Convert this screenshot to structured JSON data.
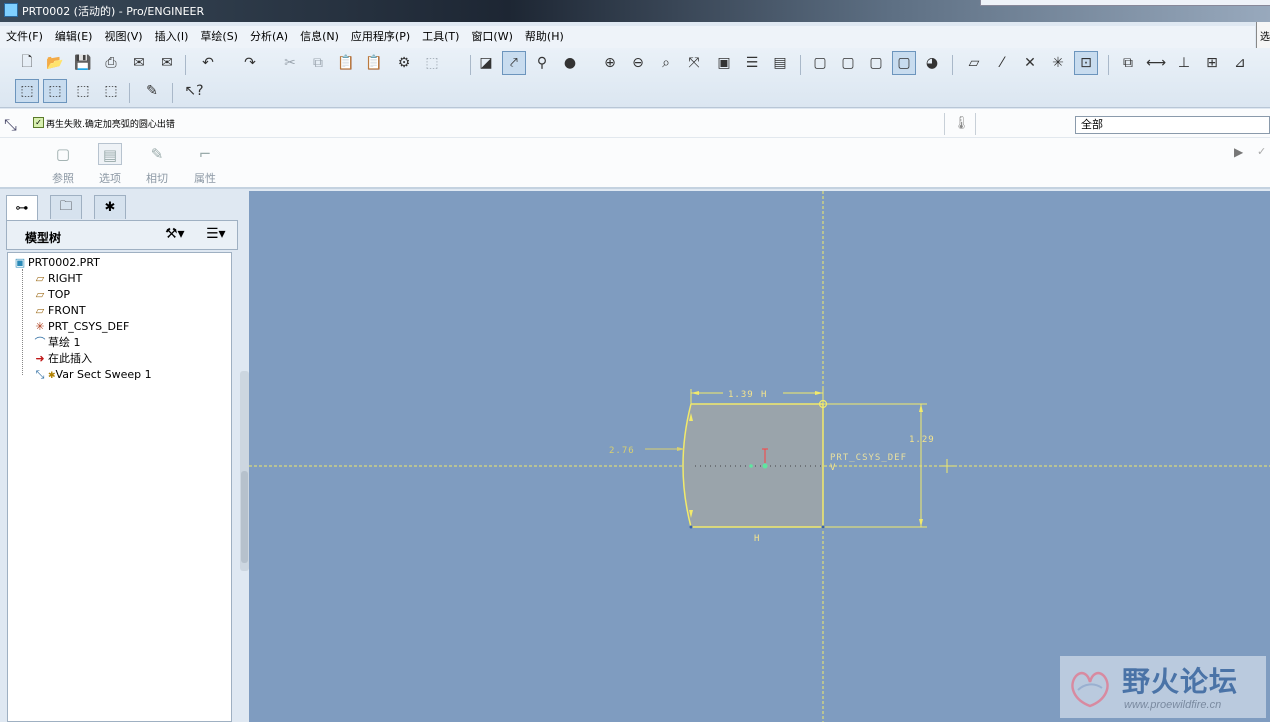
{
  "window": {
    "title": "PRT0002 (活动的) - Pro/ENGINEER"
  },
  "menu": {
    "items": [
      "文件(F)",
      "编辑(E)",
      "视图(V)",
      "插入(I)",
      "草绘(S)",
      "分析(A)",
      "信息(N)",
      "应用程序(P)",
      "工具(T)",
      "窗口(W)",
      "帮助(H)"
    ]
  },
  "side_panel": {
    "label": "选"
  },
  "dashboard": {
    "message": "再生失败.确定加亮弧的圆心出错",
    "filter_value": "全部",
    "tabs": [
      "参照",
      "选项",
      "相切",
      "属性"
    ]
  },
  "navigator": {
    "tree_title": "模型树",
    "items": [
      {
        "label": "PRT0002.PRT",
        "icon": "part-icon"
      },
      {
        "label": "RIGHT",
        "icon": "datum-plane-icon"
      },
      {
        "label": "TOP",
        "icon": "datum-plane-icon"
      },
      {
        "label": "FRONT",
        "icon": "datum-plane-icon"
      },
      {
        "label": "PRT_CSYS_DEF",
        "icon": "csys-icon"
      },
      {
        "label": "草绘 1",
        "icon": "sketch-icon"
      },
      {
        "label": "在此插入",
        "icon": "insert-here-arrow-icon"
      },
      {
        "label": "Var Sect Sweep 1",
        "icon": "sweep-feature-icon"
      }
    ]
  },
  "sketch": {
    "dim_width": "1.39",
    "dim_height": "1.29",
    "dim_radius": "2.76",
    "constraint_h_top": "H",
    "constraint_h_bottom": "H",
    "constraint_v": "V",
    "csys_label": "PRT_CSYS_DEF"
  },
  "colors": {
    "graphics_bg": "#7f9cc0",
    "sketch_yellow": "#f2ea6a",
    "section_fill": "#9aa4ab"
  },
  "watermark": {
    "text": "野火论坛",
    "url": "www.proewildfire.cn"
  }
}
